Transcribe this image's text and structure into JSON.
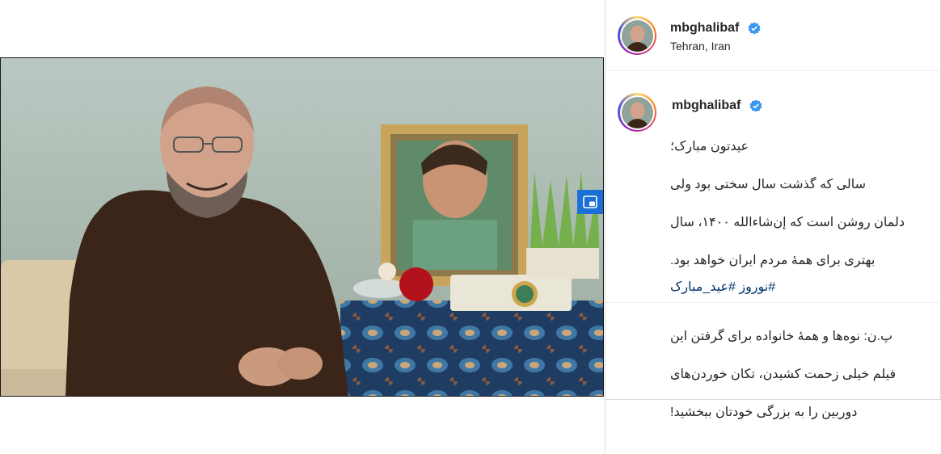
{
  "post": {
    "username": "mbghalibaf",
    "location": "Tehran, Iran",
    "caption_lines": [
      "عیدتون مبارک؛",
      "سالی که گذشت سال سختی بود ولی",
      "دلمان روشن است که إن‌شاءالله ۱۴۰۰، سال",
      "بهتری برای همهٔ مردم ایران خواهد بود.",
      "",
      "پ.ن: نوه‌ها و همهٔ خانواده برای گرفتن این",
      "فیلم خیلی زحمت کشیدن، تکان خوردن‌های",
      "دوربین را به بزرگی خودتان ببخشید!"
    ],
    "hashtags": [
      "#نوروز",
      "#عید_مبارک"
    ]
  },
  "icons": {
    "verified": "verified-badge-icon",
    "pip": "picture-in-picture-icon",
    "mute": "speaker-muted-icon"
  },
  "colors": {
    "verified_blue": "#3897f0",
    "pip_blue": "#1b6fd6",
    "hashtag_blue": "#00376b"
  }
}
